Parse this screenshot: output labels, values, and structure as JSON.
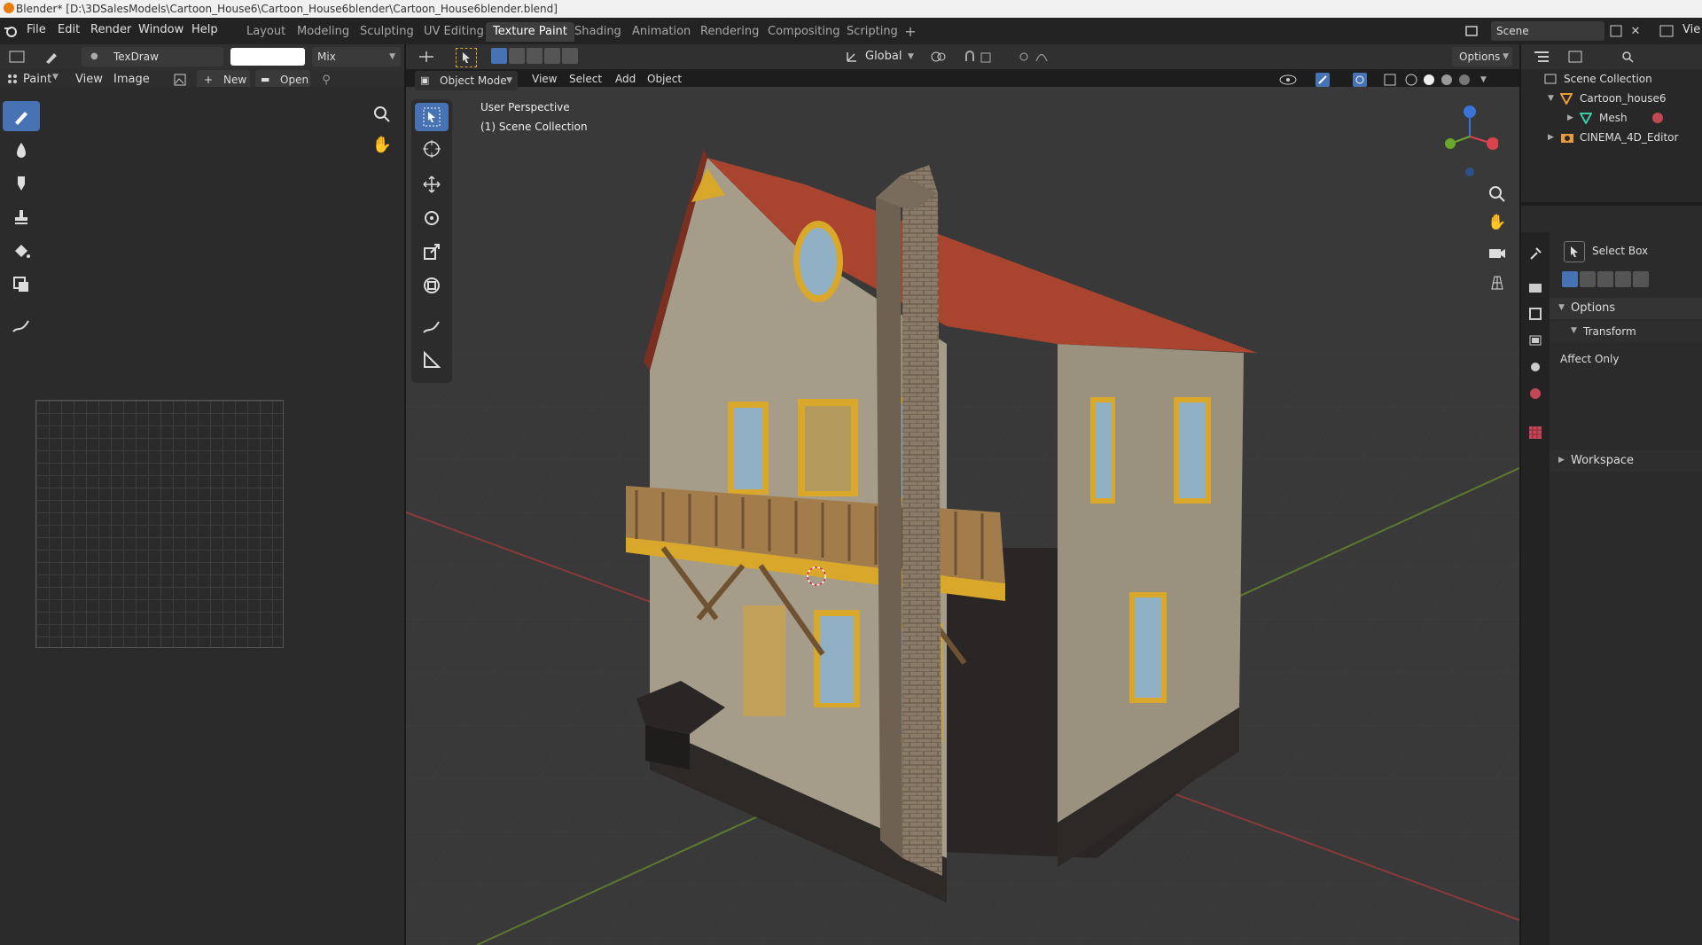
{
  "title_bar": {
    "text": "Blender* [D:\\3DSalesModels\\Cartoon_House6\\Cartoon_House6blender\\Cartoon_House6blender.blend]"
  },
  "menu": [
    "File",
    "Edit",
    "Render",
    "Window",
    "Help"
  ],
  "workspaces": [
    "Layout",
    "Modeling",
    "Sculpting",
    "UV Editing",
    "Texture Paint",
    "Shading",
    "Animation",
    "Rendering",
    "Compositing",
    "Scripting"
  ],
  "active_workspace": "Texture Paint",
  "scene": {
    "name": "Scene",
    "view_layer": "Vie"
  },
  "paint_header": {
    "brush_name": "TexDraw",
    "blend_mode": "Mix",
    "paint_menu": "Paint",
    "view": "View",
    "image": "Image",
    "new": "New",
    "open": "Open"
  },
  "viewport_header": {
    "orientation": "Global",
    "options": "Options",
    "mode": "Object Mode",
    "menus": [
      "View",
      "Select",
      "Add",
      "Object"
    ]
  },
  "viewport": {
    "perspective_label": "User Perspective",
    "collection_label": "(1) Scene Collection"
  },
  "outliner": {
    "items": [
      {
        "label": "Scene Collection"
      },
      {
        "label": "Cartoon_house6"
      },
      {
        "label": "Mesh"
      },
      {
        "label": "CINEMA_4D_Editor"
      }
    ]
  },
  "properties": {
    "tool_name": "Select Box",
    "options_label": "Options",
    "transform_label": "Transform",
    "affect_only": "Affect Only",
    "workspace_label": "Workspace"
  },
  "colors": {
    "accent": "#4772b3",
    "roof": "#a9442e",
    "wall": "#9c9484",
    "trim": "#d9a82b",
    "chimney": "#8a7a68"
  }
}
